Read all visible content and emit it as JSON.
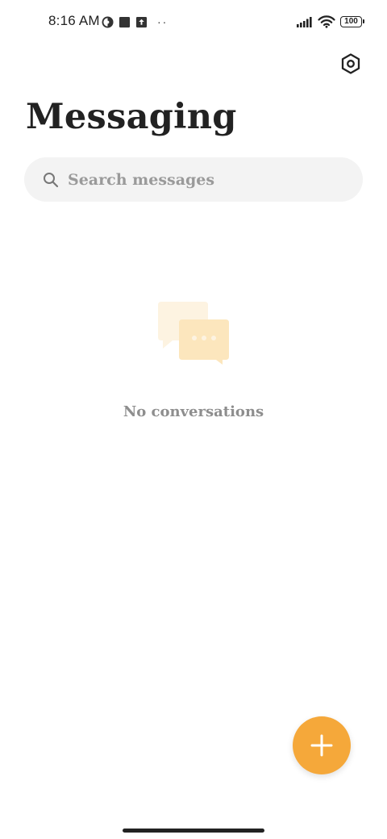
{
  "status_bar": {
    "time": "8:16 AM",
    "battery_level": "100",
    "more_indicator": "··",
    "left_icons": [
      "vpn-icon",
      "notification-square-icon",
      "upload-icon"
    ],
    "right_icons": [
      "signal-icon",
      "wifi-icon",
      "battery-icon"
    ]
  },
  "header": {
    "title": "Messaging",
    "settings_icon": "settings-hexagon-icon"
  },
  "search": {
    "placeholder": "Search messages",
    "value": "",
    "icon": "search-icon"
  },
  "empty_state": {
    "icon": "chat-bubbles-icon",
    "text": "No conversations"
  },
  "fab": {
    "icon": "plus-icon"
  },
  "colors": {
    "accent": "#f5a83a",
    "title_text": "#222222",
    "muted_text": "#8e8e8e",
    "search_background": "#f3f3f3",
    "bubble_back": "#fdf3e1",
    "bubble_front": "#fce6bd"
  }
}
